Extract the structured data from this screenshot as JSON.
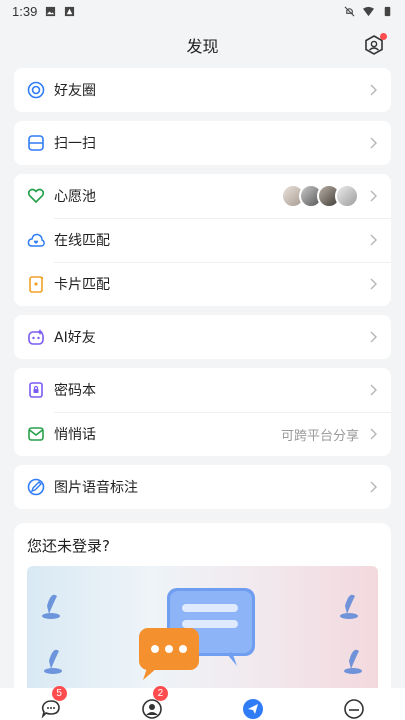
{
  "status": {
    "time": "1:39"
  },
  "header": {
    "title": "发现"
  },
  "groups": [
    {
      "rows": [
        {
          "label": "好友圈"
        }
      ]
    },
    {
      "rows": [
        {
          "label": "扫一扫"
        }
      ]
    },
    {
      "rows": [
        {
          "label": "心愿池"
        },
        {
          "label": "在线匹配"
        },
        {
          "label": "卡片匹配"
        }
      ]
    },
    {
      "rows": [
        {
          "label": "AI好友"
        }
      ]
    },
    {
      "rows": [
        {
          "label": "密码本"
        },
        {
          "label": "悄悄话",
          "hint": "可跨平台分享"
        }
      ]
    },
    {
      "rows": [
        {
          "label": "图片语音标注"
        }
      ]
    }
  ],
  "login": {
    "title": "您还未登录?"
  },
  "tabbar": {
    "messages_badge": "5",
    "contacts_badge": "2"
  },
  "colors": {
    "icon_blue": "#2f7cf6",
    "icon_green": "#27a04b",
    "icon_orange": "#f0a12a",
    "icon_purple": "#7a5cf0",
    "badge_red": "#ff4d4f"
  }
}
